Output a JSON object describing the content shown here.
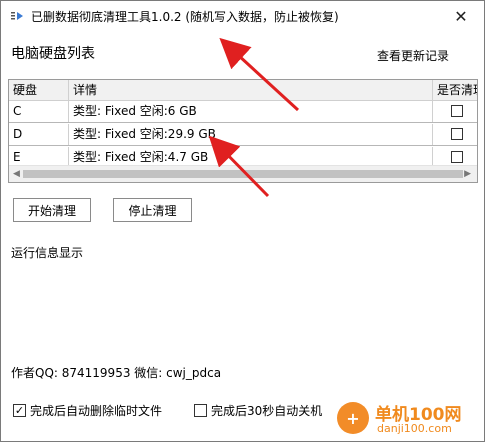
{
  "window": {
    "title": "已删数据彻底清理工具1.0.2 (随机写入数据，防止被恢复)",
    "close_glyph": "✕"
  },
  "header": {
    "heading": "电脑硬盘列表",
    "updates_link": "查看更新记录"
  },
  "table": {
    "columns": [
      "硬盘",
      "详情",
      "是否清理"
    ],
    "rows": [
      {
        "disk": "C",
        "detail": "类型: Fixed 空闲:6 GB",
        "checked": false
      },
      {
        "disk": "D",
        "detail": "类型: Fixed 空闲:29.9 GB",
        "checked": false
      },
      {
        "disk": "E",
        "detail": "类型: Fixed 空闲:4.7 GB",
        "checked": false
      }
    ]
  },
  "actions": {
    "start_label": "开始清理",
    "stop_label": "停止清理"
  },
  "log": {
    "label": "运行信息显示"
  },
  "author": {
    "text": "作者QQ: 874119953  微信: cwj_pdca"
  },
  "options": [
    {
      "label": "完成后自动删除临时文件",
      "checked": true
    },
    {
      "label": "完成后30秒自动关机",
      "checked": false
    }
  ],
  "watermark": {
    "brand": "单机100网",
    "domain": "danji100.com"
  },
  "colors": {
    "annotation_arrow": "#e02020",
    "watermark": "#f08a1e"
  }
}
